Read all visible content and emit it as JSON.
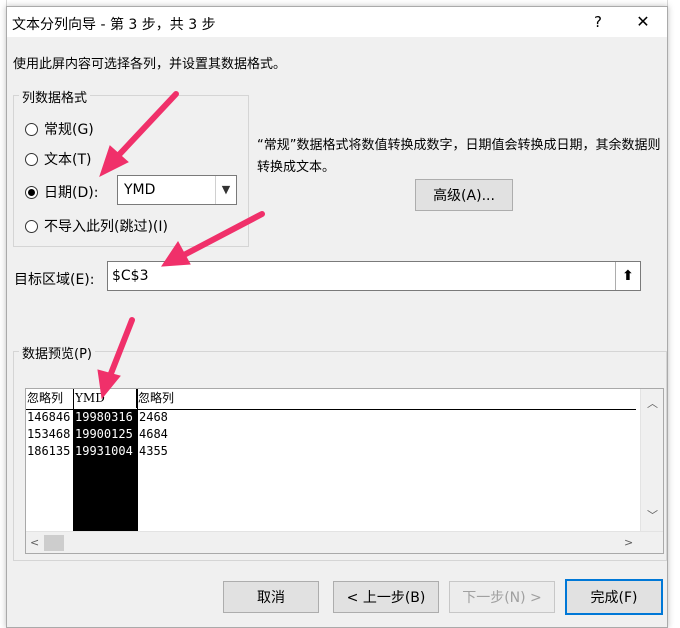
{
  "window": {
    "title": "文本分列向导 - 第 3 步，共 3 步",
    "help_label": "?",
    "close_label": "✕"
  },
  "intro_text": "使用此屏内容可选择各列，并设置其数据格式。",
  "format_group": {
    "label": "列数据格式",
    "options": [
      {
        "label": "常规(G)",
        "selected": false
      },
      {
        "label": "文本(T)",
        "selected": false
      },
      {
        "label": "日期(D):",
        "selected": true
      },
      {
        "label": "不导入此列(跳过)(I)",
        "selected": false
      }
    ],
    "date_format_value": "YMD"
  },
  "description": "“常规”数据格式将数值转换成数字，日期值会转换成日期，其余数据则转换成文本。",
  "advanced_button": "高级(A)...",
  "destination": {
    "label": "目标区域(E):",
    "value": "$C$3"
  },
  "preview": {
    "label": "数据预览(P)",
    "headers": [
      "忽略列",
      "YMD",
      "忽略列"
    ],
    "columns": [
      [
        "146846",
        "153468",
        "186135"
      ],
      [
        "19980316",
        "19900125",
        "19931004"
      ],
      [
        "2468",
        "4684",
        "4355"
      ]
    ]
  },
  "buttons": {
    "cancel": "取消",
    "back": "< 上一步(B)",
    "next": "下一步(N) >",
    "finish": "完成(F)"
  },
  "colors": {
    "accent": "#0078d7",
    "annotation": "#f0306a"
  },
  "icons": {
    "dropdown": "chevron-down-icon",
    "collapse": "collapse-dialog-icon"
  }
}
